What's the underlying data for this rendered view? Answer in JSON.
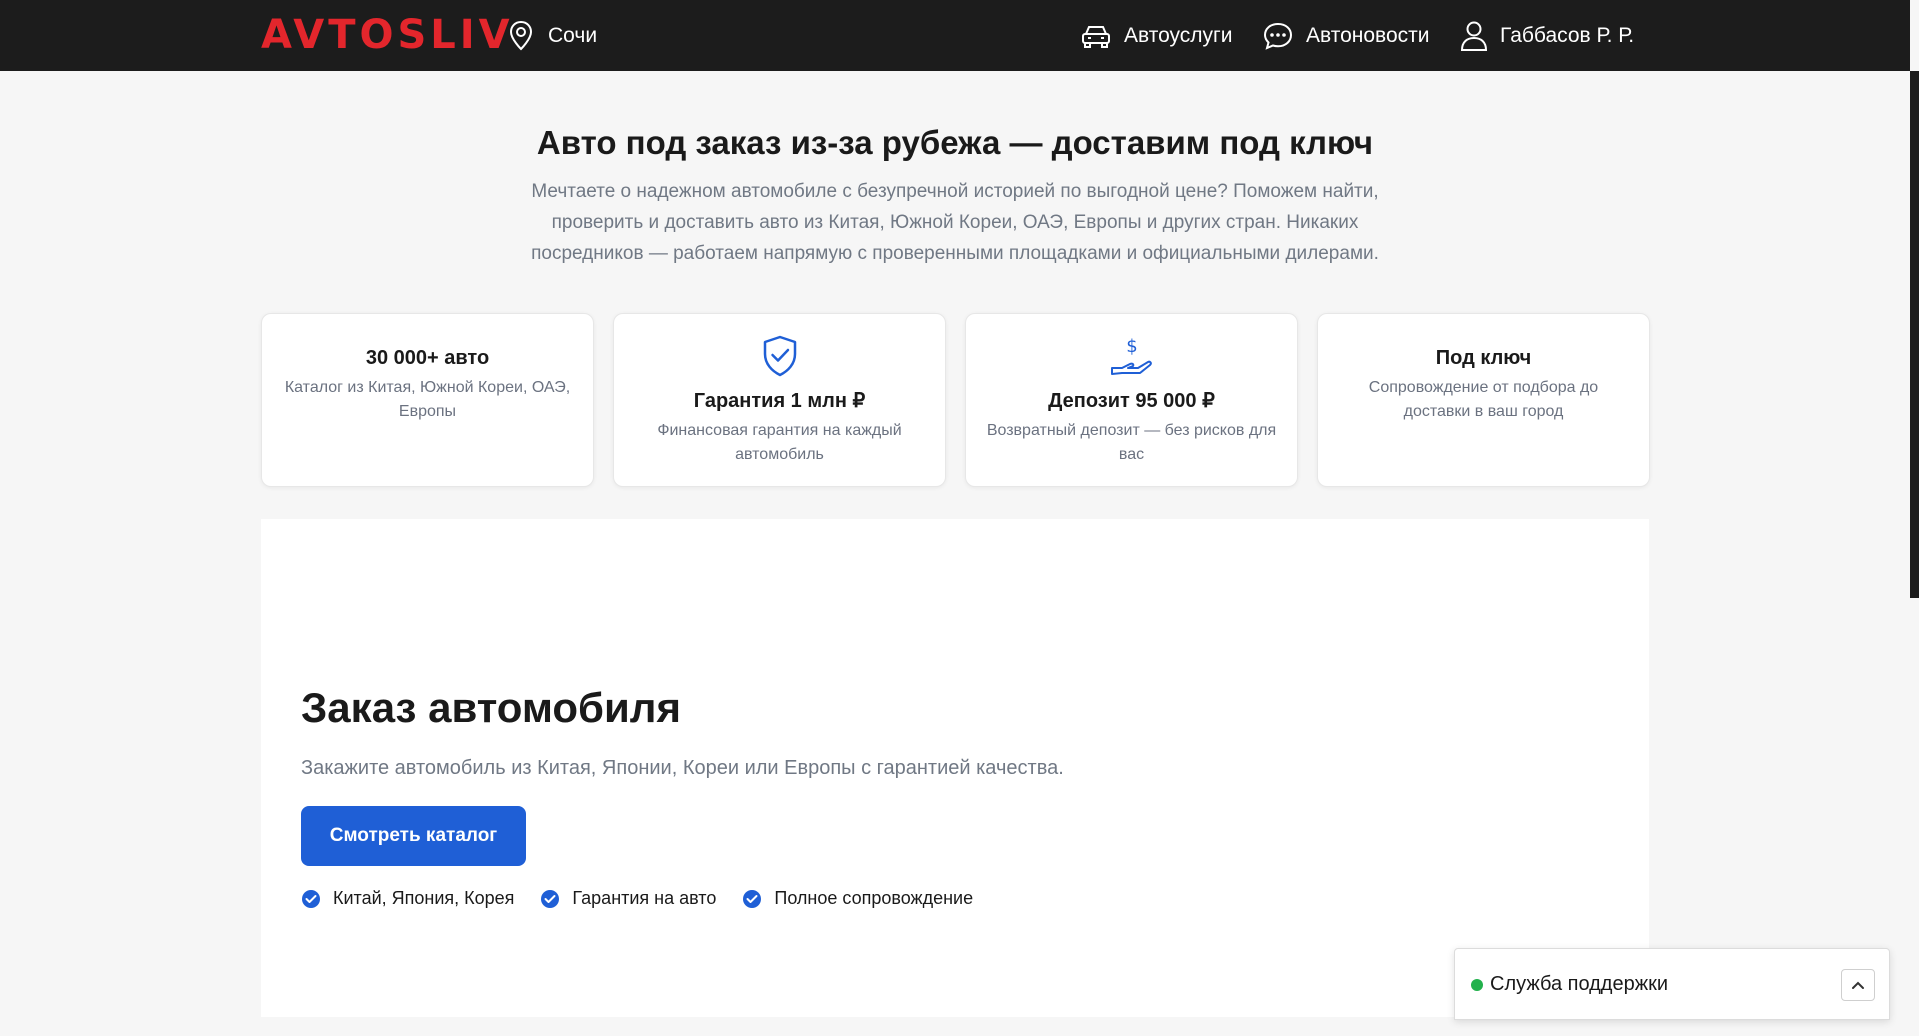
{
  "header": {
    "logo": "AVTOSLIV",
    "city": "Сочи",
    "nav": {
      "services": "Автоуслуги",
      "news": "Автоновости",
      "user": "Габбасов Р. Р."
    }
  },
  "hero": {
    "title": "Авто под заказ из-за рубежа — доставим под ключ",
    "description": "Мечтаете о надежном автомобиле с безупречной историей по выгодной цене? Поможем найти, проверить и доставить авто из Китая, Южной Кореи, ОАЭ, Европы и других стран. Никаких посредников — работаем напрямую с проверенными площадками и официальными дилерами."
  },
  "cards": [
    {
      "title": "30 000+ авто",
      "text": "Каталог из Китая, Южной Кореи, ОАЭ, Европы",
      "icon": "none"
    },
    {
      "title": "Гарантия 1 млн ₽",
      "text": "Финансовая гарантия на каждый автомобиль",
      "icon": "shield-check-icon"
    },
    {
      "title": "Депозит 95 000 ₽",
      "text": "Возвратный депозит — без рисков для вас",
      "icon": "hand-dollar-icon"
    },
    {
      "title": "Под ключ",
      "text": "Сопровождение от подбора до доставки в ваш город",
      "icon": "none"
    }
  ],
  "order": {
    "title": "Заказ автомобиля",
    "subtitle": "Закажите автомобиль из Китая, Японии, Кореи или Европы с гарантией качества.",
    "button": "Смотреть каталог",
    "features": [
      "Китай, Япония, Корея",
      "Гарантия на авто",
      "Полное сопровождение"
    ]
  },
  "support": {
    "label": "Служба поддержки",
    "status_color": "#22b14c"
  },
  "colors": {
    "brand": "#e3262c",
    "accent": "#1f5fd6",
    "header_bg": "#1c1c1c"
  }
}
